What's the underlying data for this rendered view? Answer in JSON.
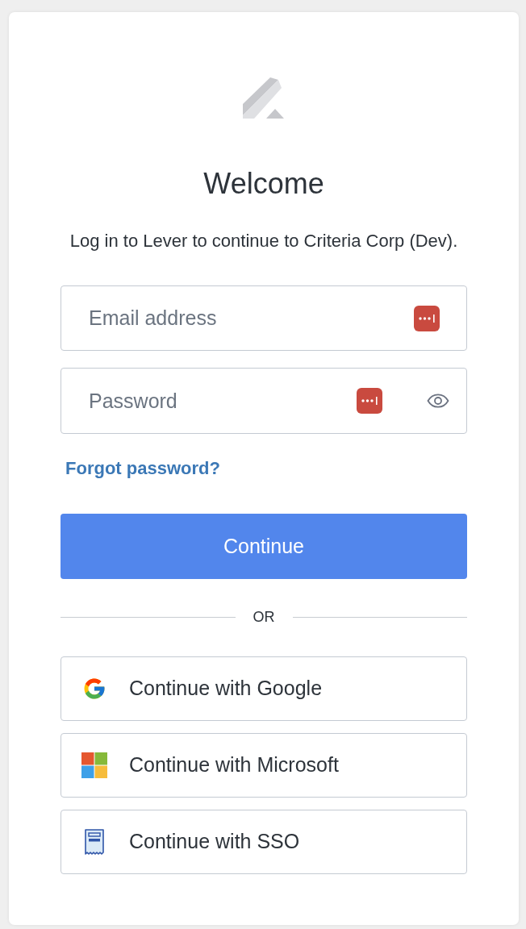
{
  "heading": "Welcome",
  "subtitle": "Log in to Lever to continue to Criteria Corp (Dev).",
  "fields": [
    {
      "kind": "email",
      "placeholder": "Email address"
    },
    {
      "kind": "password",
      "placeholder": "Password"
    }
  ],
  "forgot_password_link": "Forgot password?",
  "continue_button": "Continue",
  "divider_label": "OR",
  "providers": [
    {
      "kind": "google",
      "label": "Continue with Google"
    },
    {
      "kind": "microsoft",
      "label": "Continue with Microsoft"
    },
    {
      "kind": "sso",
      "label": "Continue with SSO"
    }
  ]
}
